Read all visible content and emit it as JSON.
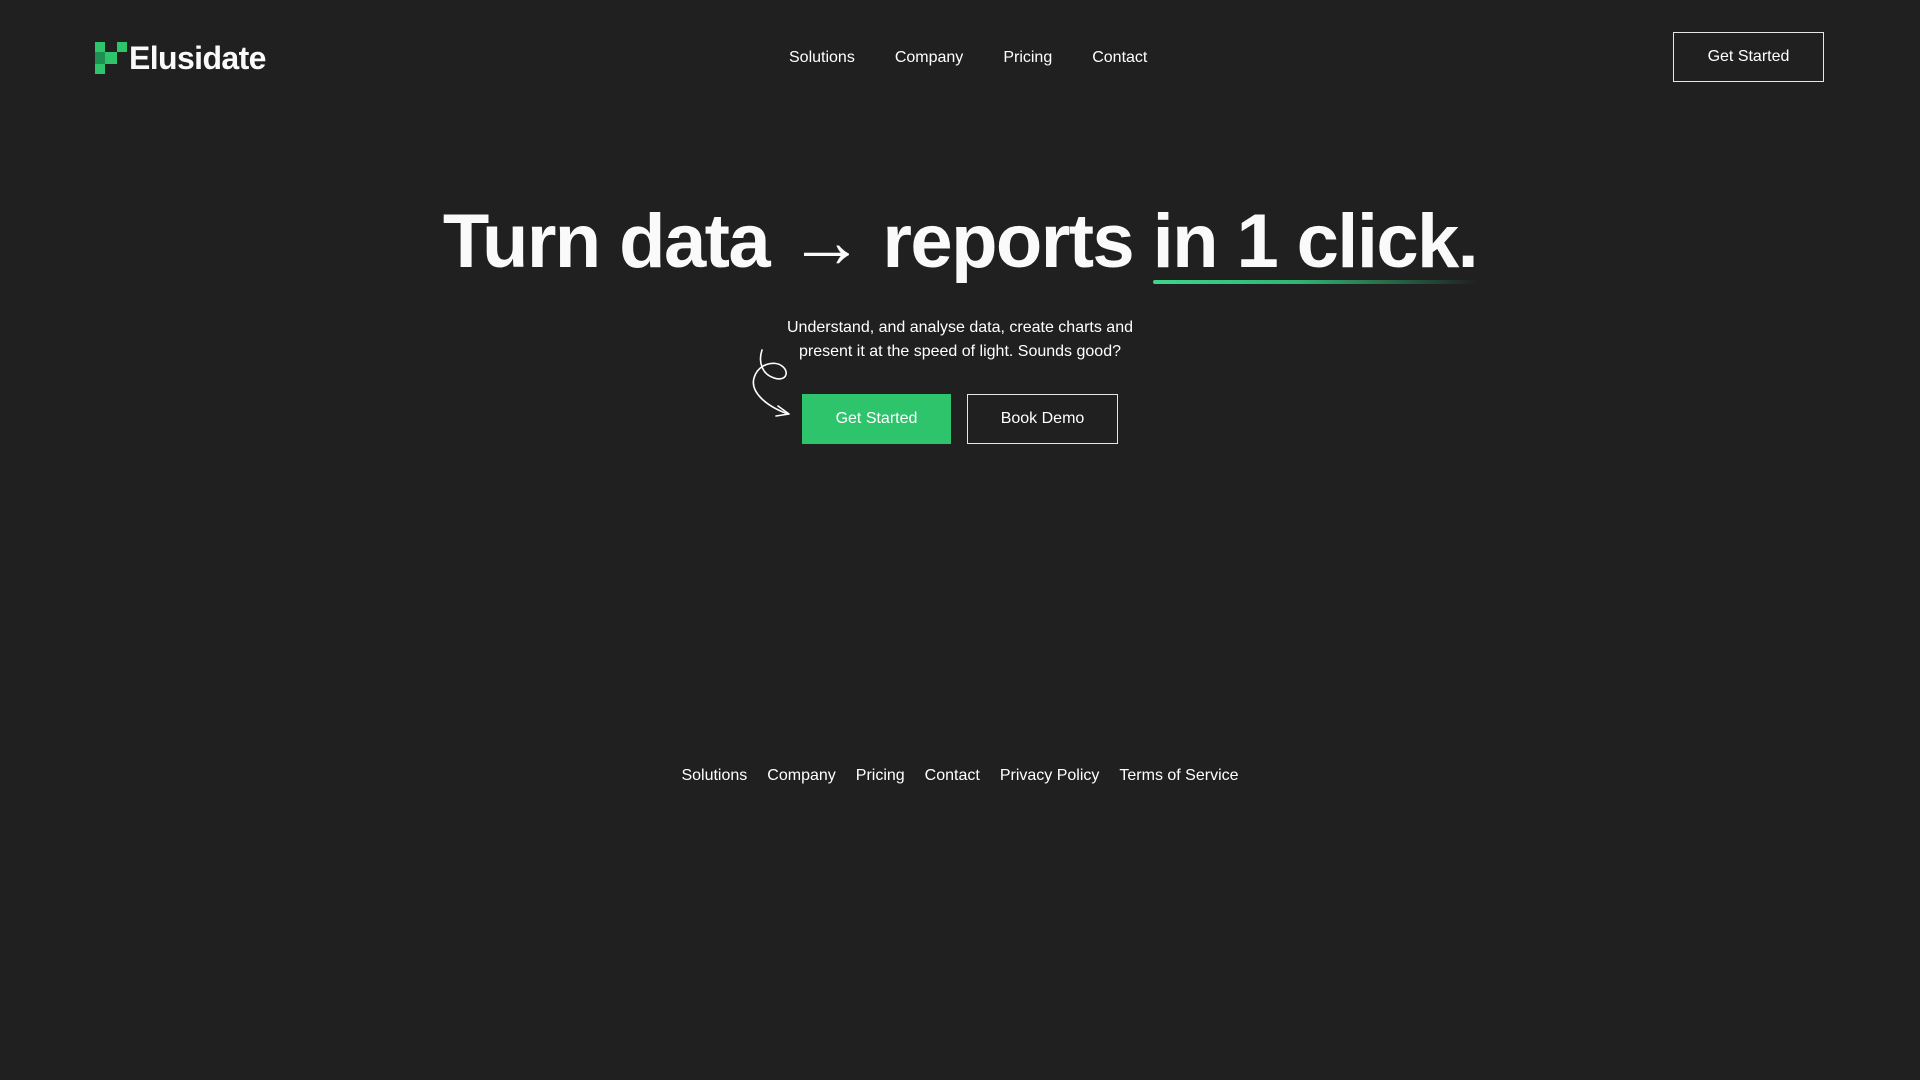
{
  "brand": {
    "name": "Elusidate",
    "accent_color": "#2dc46b",
    "background_color": "#202020"
  },
  "header": {
    "nav": [
      {
        "label": "Solutions"
      },
      {
        "label": "Company"
      },
      {
        "label": "Pricing"
      },
      {
        "label": "Contact"
      }
    ],
    "cta_label": "Get Started"
  },
  "hero": {
    "title_main": "Turn data → reports",
    "title_highlight": "in 1 click.",
    "subtitle_line1": "Understand, and analyse data, create charts and",
    "subtitle_line2": "present it at the speed of light. Sounds good?",
    "primary_button": "Get Started",
    "secondary_button": "Book Demo"
  },
  "footer": {
    "links": [
      {
        "label": "Solutions"
      },
      {
        "label": "Company"
      },
      {
        "label": "Pricing"
      },
      {
        "label": "Contact"
      },
      {
        "label": "Privacy Policy"
      },
      {
        "label": "Terms of Service"
      }
    ]
  }
}
